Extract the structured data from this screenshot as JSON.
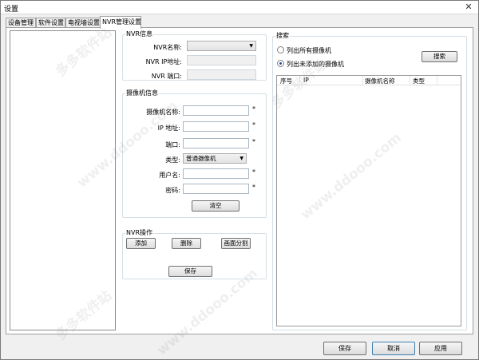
{
  "window": {
    "title": "设置",
    "close_glyph": "✕"
  },
  "tabs": [
    {
      "label": "设备管理",
      "active": false
    },
    {
      "label": "软件设置",
      "active": false
    },
    {
      "label": "电视墙设置",
      "active": false
    },
    {
      "label": "NVR管理设置",
      "active": true
    }
  ],
  "nvr_info": {
    "title": "NVR信息",
    "name_label": "NVR名称:",
    "ip_label": "NVR IP地址:",
    "port_label": "NVR 端口:",
    "name_value": ""
  },
  "camera_info": {
    "title": "摄像机信息",
    "name_label": "摄像机名称:",
    "ip_label": "IP 地址:",
    "port_label": "端口:",
    "type_label": "类型:",
    "type_value": "普通摄像机",
    "user_label": "用户名:",
    "password_label": "密码:",
    "required_mark": "*",
    "clear_button": "清空"
  },
  "nvr_ops": {
    "title": "NVR操作",
    "add_button": "添加",
    "delete_button": "删除",
    "split_button": "画面分割",
    "save_button": "保存"
  },
  "search": {
    "title": "搜索",
    "option_all": "列出所有摄像机",
    "option_unadded": "列出未添加的摄像机",
    "selected_option": "option_unadded",
    "search_button": "搜索",
    "columns": [
      "序号",
      "IP",
      "摄像机名称",
      "类型"
    ]
  },
  "footer": {
    "save_button": "保存",
    "cancel_button": "取消",
    "apply_button": "应用"
  },
  "watermark": {
    "text_cn": "多多软件站",
    "text_url": "www.ddooo.com"
  }
}
